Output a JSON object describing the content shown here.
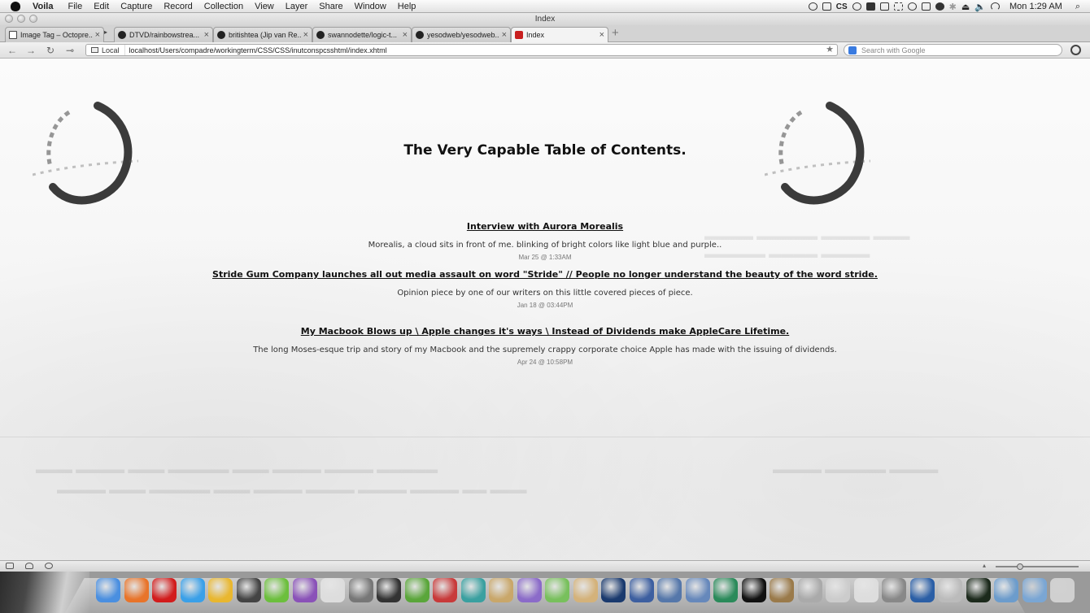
{
  "menubar": {
    "app_name": "Voila",
    "items": [
      "File",
      "Edit",
      "Capture",
      "Record",
      "Collection",
      "View",
      "Layer",
      "Share",
      "Window",
      "Help"
    ],
    "status_icons": [
      "gear-icon",
      "wine-glass-icon",
      "cs-icon",
      "headphones-icon",
      "dropbox-icon",
      "window-icon",
      "selection-icon",
      "circle-icon",
      "edit-icon",
      "cloud-icon",
      "bluetooth-icon",
      "eject-icon",
      "volume-icon",
      "wifi-icon"
    ],
    "cs_label": "CS",
    "clock": "Mon 1:29 AM"
  },
  "window": {
    "title": "Index"
  },
  "tabs": [
    {
      "label": "Image Tag – Octopre...",
      "icon": "box",
      "active": false
    },
    {
      "label": "DTVD/rainbowstrea...",
      "icon": "github",
      "active": false
    },
    {
      "label": "britishtea (Jip van Re...",
      "icon": "github",
      "active": false
    },
    {
      "label": "swannodette/logic-t...",
      "icon": "github",
      "active": false
    },
    {
      "label": "yesodweb/yesodweb...",
      "icon": "github",
      "active": false
    },
    {
      "label": "Index",
      "icon": "red",
      "active": true
    }
  ],
  "tab_overflow": "▸",
  "navbar": {
    "identity_label": "Local",
    "url": "localhost/Users/compadre/workingterm/CSS/CSS/inutconspcsshtml/index.xhtml",
    "search_placeholder": "Search with Google"
  },
  "page": {
    "title": "The Very Capable Table of Contents.",
    "entries": [
      {
        "title": "Interview with Aurora Morealis",
        "description": "Morealis, a cloud sits in front of me. blinking of bright colors like light blue and purple..",
        "date": "Mar 25 @ 1:33AM"
      },
      {
        "title": "Stride Gum Company launches all out media assault on word \"Stride\" // People no longer understand the beauty of the word stride.",
        "description": "Opinion piece by one of our writers on this little covered pieces of piece.",
        "date": "Jan 18 @ 03:44PM"
      },
      {
        "title": "My Macbook Blows up \\ Apple changes it's ways \\ Instead of Dividends make AppleCare Lifetime.",
        "description": "The long Moses-esque trip and story of my Macbook and the supremely crappy corporate choice Apple has made with the issuing of dividends.",
        "date": "Apr 24 @ 10:58PM"
      }
    ]
  },
  "dock": {
    "icons": [
      {
        "name": "finder-icon",
        "color": "#4a8fe0"
      },
      {
        "name": "firefox-icon",
        "color": "#e8742a"
      },
      {
        "name": "opera-icon",
        "color": "#d21c1c"
      },
      {
        "name": "itunes-icon",
        "color": "#3aa0e8"
      },
      {
        "name": "gold-app-icon",
        "color": "#e9b72f"
      },
      {
        "name": "speaker-icon",
        "color": "#444444"
      },
      {
        "name": "leaf-app-icon",
        "color": "#6cbf3d"
      },
      {
        "name": "purple-app-icon",
        "color": "#8a52b8"
      },
      {
        "name": "paper-app-icon",
        "color": "#dddddd"
      },
      {
        "name": "pen-app-icon",
        "color": "#777777"
      },
      {
        "name": "camera-app-icon",
        "color": "#333333"
      },
      {
        "name": "evernote-icon",
        "color": "#5aa63a"
      },
      {
        "name": "red-app-icon",
        "color": "#c83a3a"
      },
      {
        "name": "image-app-icon",
        "color": "#3aa0a0"
      },
      {
        "name": "preview-icon",
        "color": "#c9a76a"
      },
      {
        "name": "box-app-icon",
        "color": "#8b6bc9"
      },
      {
        "name": "green-app-icon",
        "color": "#78c05c"
      },
      {
        "name": "package-icon",
        "color": "#d4b27a"
      },
      {
        "name": "photoshop-icon",
        "color": "#1a3a6e"
      },
      {
        "name": "compass-icon",
        "color": "#3d5fa0"
      },
      {
        "name": "dashboard-icon",
        "color": "#5577aa"
      },
      {
        "name": "xcode-icon",
        "color": "#6688bb"
      },
      {
        "name": "chart-app-icon",
        "color": "#2a8a5a"
      },
      {
        "name": "terminal-icon",
        "color": "#111111"
      },
      {
        "name": "gimp-icon",
        "color": "#9a7a4a"
      },
      {
        "name": "utility-icon",
        "color": "#aaaaaa"
      },
      {
        "name": "file-app-icon",
        "color": "#cccccc"
      },
      {
        "name": "notes-app-icon",
        "color": "#dddddd"
      },
      {
        "name": "system-prefs-icon",
        "color": "#888888"
      },
      {
        "name": "quicktime-icon",
        "color": "#2b5fa6"
      },
      {
        "name": "wrench-app-icon",
        "color": "#bbbbbb"
      },
      {
        "name": "activity-monitor-icon",
        "color": "#1c2a1c"
      },
      {
        "name": "applications-folder-icon",
        "color": "#6c9ccc"
      },
      {
        "name": "downloads-folder-icon",
        "color": "#7aa6d4"
      },
      {
        "name": "trash-icon",
        "color": "#d0d0d0"
      }
    ]
  }
}
